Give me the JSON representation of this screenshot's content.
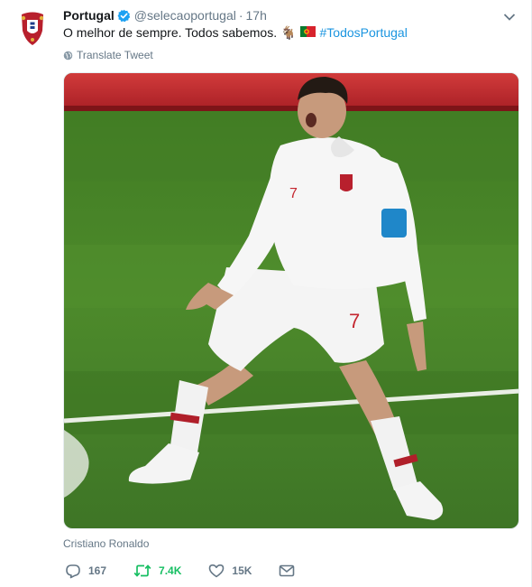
{
  "account": {
    "display_name": "Portugal",
    "handle": "@selecaoportugal",
    "separator": "·",
    "time": "17h",
    "avatar_icon": "fpf-crest-icon",
    "verified_icon": "verified-badge-icon"
  },
  "tweet": {
    "text": "O melhor de sempre. Todos sabemos.",
    "emoji_1": "🐐",
    "emoji_2": "🇵🇹",
    "hashtag": "#TodosPortugal",
    "translate_label": "Translate Tweet"
  },
  "media": {
    "caption": "Cristiano Ronaldo",
    "jersey_number": "7"
  },
  "actions": {
    "replies": "167",
    "retweets": "7.4K",
    "likes": "15K"
  },
  "colors": {
    "link": "#1b95e0",
    "muted": "#657786",
    "retweet": "#17bf63",
    "verified": "#1da1f2",
    "pitch": "#4d8a2b"
  }
}
